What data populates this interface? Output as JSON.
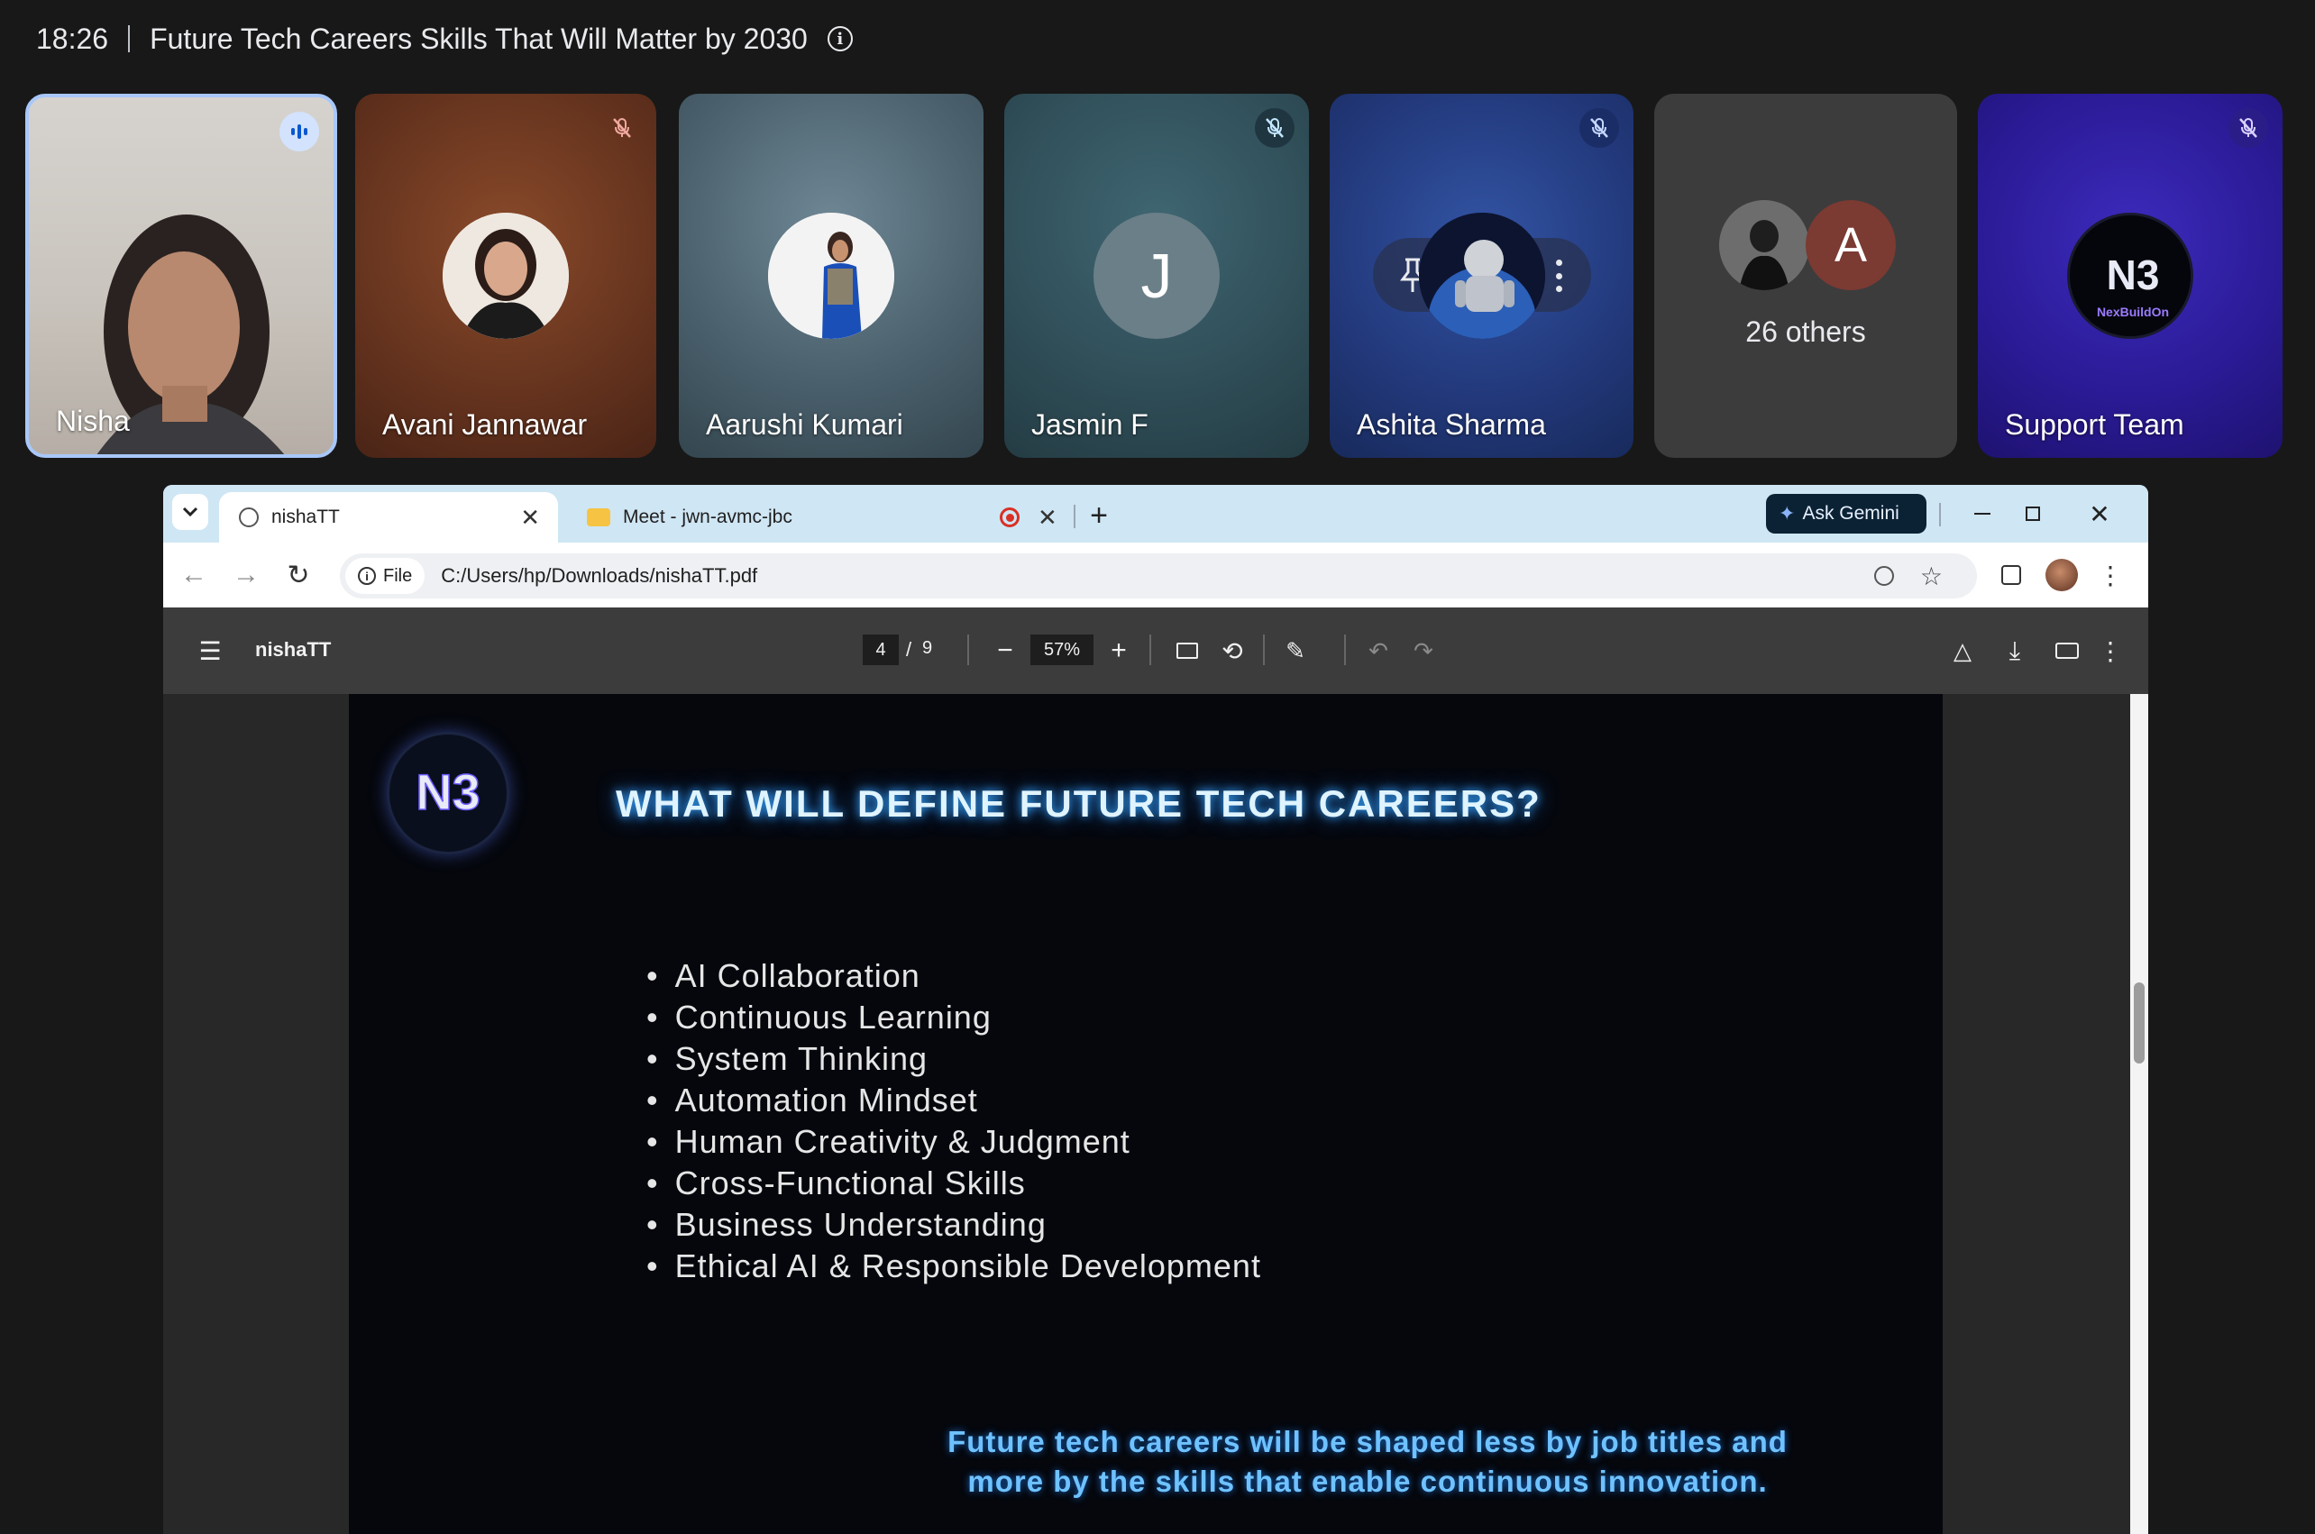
{
  "meeting": {
    "time": "18:26",
    "title": "Future Tech Careers Skills That Will Matter by 2030"
  },
  "participants": [
    {
      "name": "Nisha",
      "speaking": true
    },
    {
      "name": "Avani Jannawar",
      "muted": true
    },
    {
      "name": "Aarushi Kumari"
    },
    {
      "name": "Jasmin F",
      "initial": "J",
      "muted": true
    },
    {
      "name": "Ashita Sharma",
      "muted": true
    },
    {
      "name": "26 others",
      "initial": "A"
    },
    {
      "name": "Support Team",
      "muted": true
    }
  ],
  "browser": {
    "tabs": [
      {
        "label": "nishaTT"
      },
      {
        "label": "Meet - jwn-avmc-jbc"
      }
    ],
    "ask_gemini": "Ask Gemini",
    "file_chip": "File",
    "url": "C:/Users/hp/Downloads/nishaTT.pdf"
  },
  "pdf": {
    "title": "nishaTT",
    "page_current": "4",
    "page_sep": "/",
    "page_total": "9",
    "zoom": "57%"
  },
  "slide": {
    "title": "WHAT WILL DEFINE FUTURE TECH CAREERS?",
    "bullets": [
      "AI Collaboration",
      "Continuous Learning",
      "System Thinking",
      "Automation Mindset",
      "Human Creativity & Judgment",
      "Cross-Functional Skills",
      "Business Understanding",
      "Ethical AI & Responsible Development"
    ],
    "footer_line1": "Future tech careers will be shaped less by job titles and",
    "footer_line2": "more by the skills that enable continuous innovation."
  },
  "logo": {
    "text": "NexBuildOn"
  }
}
